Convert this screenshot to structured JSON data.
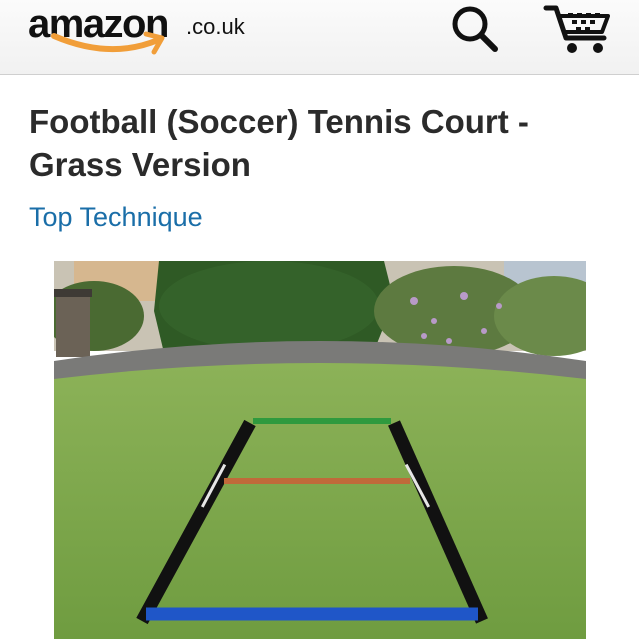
{
  "header": {
    "logo_word": "amazon",
    "logo_domain": ".co.uk",
    "search_icon": "search-icon",
    "cart_icon": "cart-icon"
  },
  "product": {
    "title": "Football (Soccer) Tennis Court - Grass Version",
    "brand": "Top Technique",
    "image_label": "product-photo"
  },
  "colors": {
    "brand_link": "#1a6ea8",
    "logo_smile": "#f19e39",
    "title_text": "#2b2b2b",
    "header_bg": "#f5f5f5",
    "grass": "#7ca64a",
    "court_green": "#2f9a3e",
    "court_orange": "#c06a3a",
    "court_blue": "#1f56c8",
    "court_black": "#111111"
  }
}
